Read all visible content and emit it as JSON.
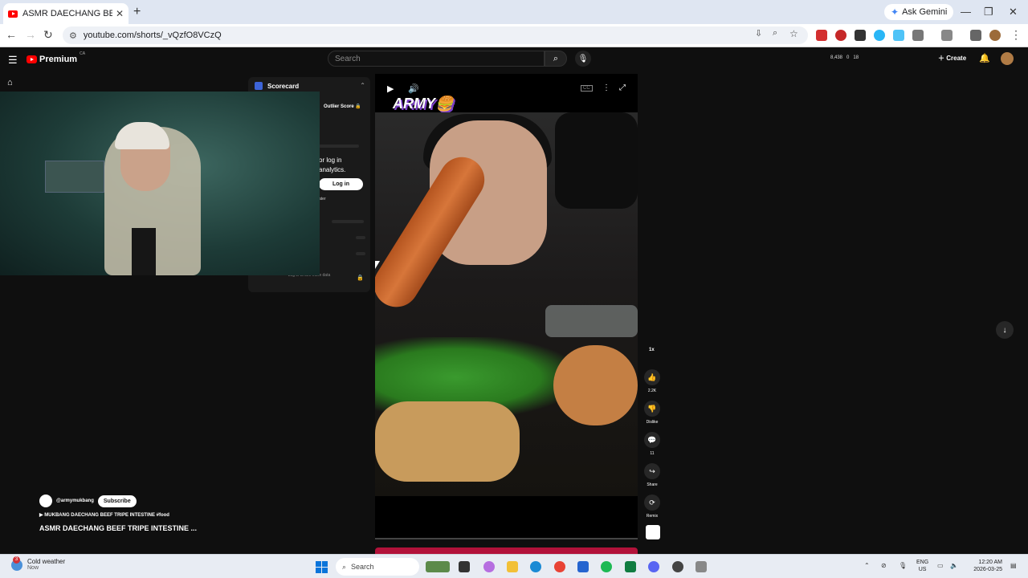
{
  "browser": {
    "tab_title": "ASMR DAECHANG BEEF TRIPE",
    "tab_close": "✕",
    "new_tab": "+",
    "gemini_label": "Ask Gemini",
    "url": "youtube.com/shorts/_vQzfO8VCzQ",
    "window_controls": [
      "—",
      "❐",
      "✕"
    ]
  },
  "youtube": {
    "logo_text": "Premium",
    "logo_region": "CA",
    "search_placeholder": "Search",
    "stats": [
      "8,438",
      "0",
      "18"
    ],
    "create_label": "Create"
  },
  "scorecard": {
    "title": "Scorecard",
    "outlier_label": "Outlier Score",
    "message_line1": "or log in",
    "message_line2": "analytics.",
    "login_label": "Log in",
    "footer": "Log in to see more data",
    "ater": "ater"
  },
  "player": {
    "overlay_title": "ARMY🍔"
  },
  "actions": {
    "speed": "1x",
    "likes": "2.2K",
    "dislike_label": "Dislike",
    "comments": "11",
    "share_label": "Share",
    "remix_label": "Remix"
  },
  "video_info": {
    "channel": "@armymukbang",
    "subscribe_label": "Subscribe",
    "playlist": "MUKBANG DAECHANG BEEF TRIPE INTESTINE #food",
    "title": "ASMR DAECHANG BEEF TRIPE INTESTINE ..."
  },
  "taskbar": {
    "weather_title": "Cold weather",
    "weather_sub": "Now",
    "weather_badge": "3",
    "search_label": "Search",
    "lang_line1": "ENG",
    "lang_line2": "US",
    "time": "12:20 AM",
    "date": "2026-03-25"
  },
  "colors": {
    "youtube_red": "#ff0000",
    "scorecard_accent": "#3d64d8",
    "overlay_purple": "#7c3fc8"
  }
}
